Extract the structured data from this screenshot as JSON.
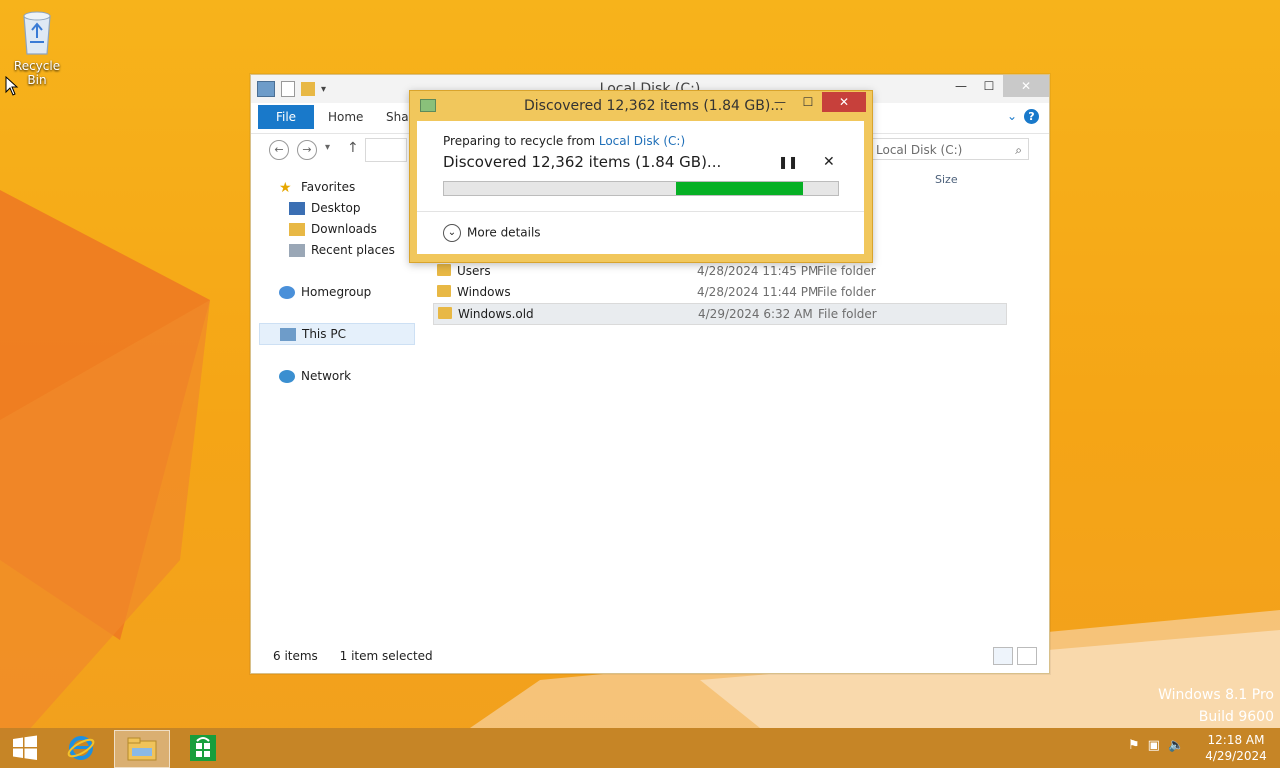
{
  "desktop": {
    "icons": [
      {
        "label": "Recycle Bin",
        "icon": "recycle-bin-icon"
      }
    ],
    "watermark": {
      "line1": "Windows 8.1 Pro",
      "line2": "Build 9600"
    }
  },
  "explorer": {
    "title": "Local Disk (C:)",
    "tabs": {
      "file": "File",
      "home": "Home",
      "share": "Shar"
    },
    "search_placeholder": "Local Disk (C:)",
    "column_size": "Size",
    "sidebar": {
      "favorites": "Favorites",
      "desktop": "Desktop",
      "downloads": "Downloads",
      "recent": "Recent places",
      "homegroup": "Homegroup",
      "thispc": "This PC",
      "network": "Network"
    },
    "files": [
      {
        "name": "Users",
        "date": "4/28/2024 11:45 PM",
        "type": "File folder"
      },
      {
        "name": "Windows",
        "date": "4/28/2024 11:44 PM",
        "type": "File folder"
      },
      {
        "name": "Windows.old",
        "date": "4/29/2024 6:32 AM",
        "type": "File folder",
        "selected": true
      }
    ],
    "status": {
      "items": "6 items",
      "selected": "1 item selected"
    }
  },
  "dialog": {
    "title": "Discovered 12,362 items (1.84 GB)...",
    "preparing_prefix": "Preparing to recycle from",
    "preparing_link": "Local Disk (C:)",
    "status": "Discovered 12,362 items (1.84 GB)...",
    "progress": {
      "start_fraction": 0.59,
      "end_fraction": 0.91,
      "color": "#06b025"
    },
    "more_details": "More details"
  },
  "taskbar": {
    "clock": {
      "time": "12:18 AM",
      "date": "4/29/2024"
    }
  },
  "colors": {
    "accent": "#1979ca",
    "desktop": "#f5a516",
    "close": "#c7403b"
  }
}
